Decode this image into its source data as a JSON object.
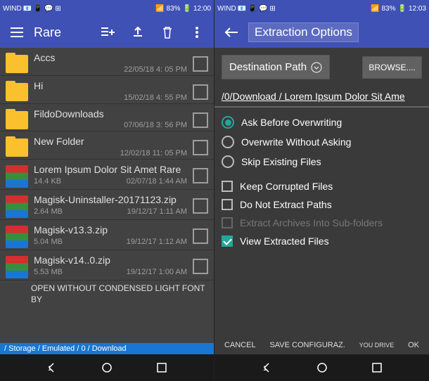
{
  "left": {
    "status": {
      "carrier": "WIND",
      "battery": "83%",
      "time": "12:00"
    },
    "title": "Rare",
    "files": [
      {
        "name": "Accs",
        "date": "22/05/18 4: 05 PM",
        "size": "",
        "type": "folder"
      },
      {
        "name": "Hi",
        "date": "15/02/18 4: 55 PM",
        "size": "",
        "type": "folder"
      },
      {
        "name": "FildoDownloads",
        "date": "07/06/18 3: 56 PM",
        "size": "",
        "type": "folder"
      },
      {
        "name": "New Folder",
        "date": "12/02/18 11: 05 PM",
        "size": "",
        "type": "folder"
      },
      {
        "name": "Lorem Ipsum Dolor Sit Amet  Rare",
        "date": "02/07/18 1:44 AM",
        "size": "14.4 KB",
        "type": "rar"
      },
      {
        "name": "Magisk-Uninstaller-20171123.zip",
        "date": "19/12/17 1:11 AM",
        "size": "2.64 MB",
        "type": "rar"
      },
      {
        "name": "Magisk-v13.3.zip",
        "date": "19/12/17 1:12 AM",
        "size": "5.04 MB",
        "type": "rar"
      },
      {
        "name": "Magisk-v14..0.zip",
        "date": "19/12/17 1:00 AM",
        "size": "5.53 MB",
        "type": "rar"
      }
    ],
    "open_without": "OPEN WITHOUT CONDENSED LIGHT FONT BY",
    "breadcrumb": "/ Storage / Emulated / 0 / Download"
  },
  "right": {
    "status": {
      "carrier": "WIND",
      "battery": "83%",
      "time": "12:03"
    },
    "title": "Extraction Options",
    "dest_label": "Destination Path",
    "browse": "BROWSE....",
    "path": "/0/Download / Lorem Ipsum Dolor Sit Ame",
    "radios": [
      {
        "label": "Ask Before Overwriting",
        "on": true
      },
      {
        "label": "Overwrite Without Asking",
        "on": false
      },
      {
        "label": "Skip Existing Files",
        "on": false
      }
    ],
    "checks": [
      {
        "label": "Keep Corrupted Files",
        "on": false,
        "disabled": false
      },
      {
        "label": "Do Not Extract Paths",
        "on": false,
        "disabled": false
      },
      {
        "label": "Extract Archives Into Sub-folders",
        "on": false,
        "disabled": true
      },
      {
        "label": "View Extracted Files",
        "on": true,
        "disabled": false
      }
    ],
    "actions": {
      "cancel": "CANCEL",
      "save": "SAVE CONFIGURAZ.",
      "drive": "YOU DRIVE",
      "ok": "OK"
    }
  }
}
